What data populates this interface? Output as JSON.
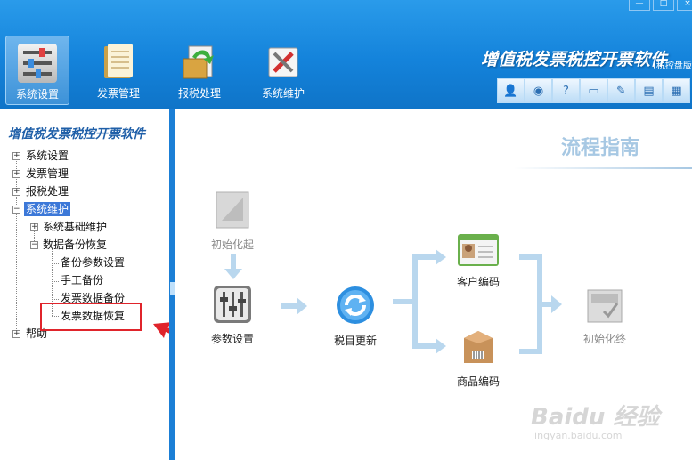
{
  "window": {
    "minimize": "—",
    "maximize": "□"
  },
  "toolbar": {
    "items": [
      {
        "label": "系统设置",
        "icon": "settings-sliders-icon"
      },
      {
        "label": "发票管理",
        "icon": "invoice-folder-icon"
      },
      {
        "label": "报税处理",
        "icon": "tax-report-icon"
      },
      {
        "label": "系统维护",
        "icon": "maintenance-tools-icon"
      }
    ],
    "app_title": "增值税发票税控开票软件",
    "app_subtitle": "(税控盘版)",
    "icons": [
      "user-icon",
      "globe-icon",
      "help-icon",
      "window-icon",
      "key-icon",
      "lock-calendar-icon",
      "calculator-icon"
    ]
  },
  "sidebar": {
    "title": "增值税发票税控开票软件",
    "tree": {
      "n1": "系统设置",
      "n2": "发票管理",
      "n3": "报税处理",
      "n4": "系统维护",
      "n4_1": "系统基础维护",
      "n4_2": "数据备份恢复",
      "n4_2_1": "备份参数设置",
      "n4_2_2": "手工备份",
      "n4_2_3": "发票数据备份",
      "n4_2_4": "发票数据恢复",
      "n5": "帮助"
    }
  },
  "flow": {
    "title": "流程指南",
    "steps": {
      "init_start": "初始化起",
      "params": "参数设置",
      "tax_update": "税目更新",
      "customer_code": "客户编码",
      "product_code": "商品编码",
      "init_end": "初始化终"
    }
  },
  "watermark": {
    "main": "Baidu 经验",
    "sub": "jingyan.baidu.com"
  }
}
